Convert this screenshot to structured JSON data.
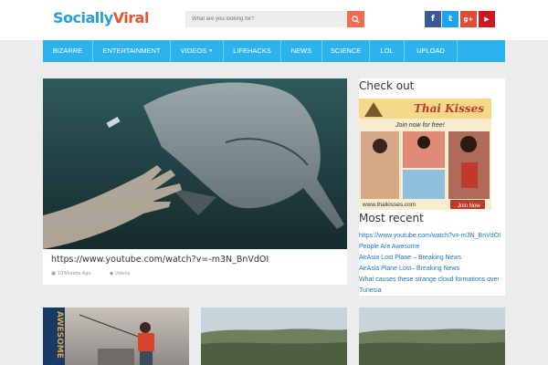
{
  "header": {
    "logo_part1": "Socially",
    "logo_part2": "Viral",
    "search_placeholder": "What are you looking for?",
    "social": {
      "facebook": "f",
      "twitter": "t",
      "googleplus": "g+",
      "youtube": "▶"
    }
  },
  "nav": {
    "items": [
      "BIZARRE",
      "ENTERTAINMENT",
      "VIDEOS",
      "LIFEHACKS",
      "NEWS",
      "SCIENCE",
      "LOL",
      "UPLOAD"
    ]
  },
  "feature": {
    "title": "https://www.youtube.com/watch?v=-m3N_BnVdOI",
    "time": "10 Months Ago",
    "category": "Videos"
  },
  "sidebar": {
    "check_out": "Check out",
    "ad": {
      "brand": "Thai Kisses",
      "tagline": "Join now for free!",
      "url": "www.thaikisses.com",
      "button": "Join Now"
    },
    "most_recent": "Most recent",
    "recent_links": [
      "https://www.youtube.com/watch?v=-m3N_BnVdOI",
      "People Are Awesome",
      "AirAsia Lost Plane – Breaking News",
      "AirAsia Plane Lost– Breaking News",
      "What causes these strange cloud formations over",
      "Tunesia"
    ]
  },
  "thumbs": {
    "first_overlay": "AWESOME"
  },
  "colors": {
    "accent": "#2cb2ec",
    "search_button": "#f26d4f",
    "link": "#1e73be"
  }
}
